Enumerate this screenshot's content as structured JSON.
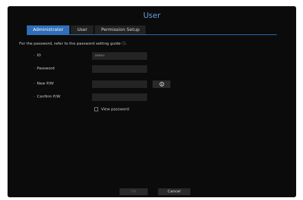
{
  "window": {
    "title": "User"
  },
  "tabs": [
    {
      "label": "Administrator",
      "active": true
    },
    {
      "label": "User",
      "active": false
    },
    {
      "label": "Permission Setup",
      "active": false
    }
  ],
  "guide_text": "For the password, refer to the password setting guide ⓘ.",
  "form": {
    "id": {
      "label": "ID",
      "value": "admin"
    },
    "password": {
      "label": "Password",
      "value": ""
    },
    "new_password": {
      "label": "New P/W",
      "value": ""
    },
    "confirm_password": {
      "label": "Confirm P/W",
      "value": ""
    },
    "view_password": {
      "label": "View password",
      "checked": false
    }
  },
  "info_icon": "info-circle-icon",
  "footer": {
    "ok_label": "OK",
    "cancel_label": "Cancel"
  },
  "colors": {
    "accent": "#2f6fb8",
    "title": "#6aa3e6",
    "background": "#0b0b0b"
  }
}
